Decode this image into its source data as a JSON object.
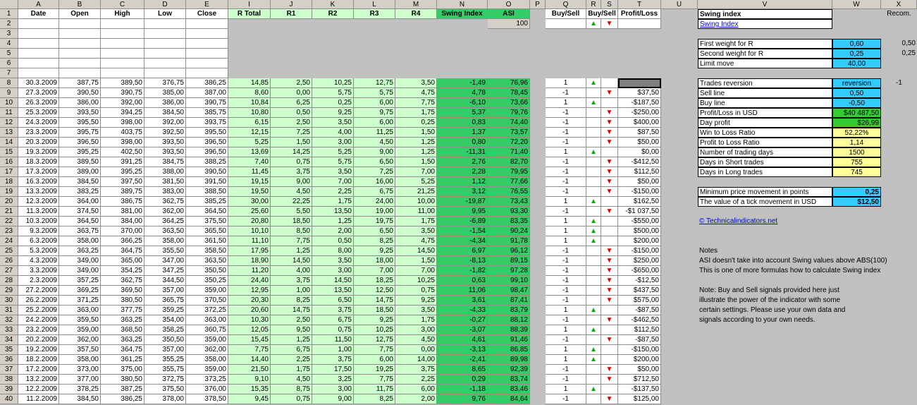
{
  "columns": [
    "A",
    "B",
    "C",
    "D",
    "E",
    "I",
    "J",
    "K",
    "L",
    "M",
    "N",
    "O",
    "P",
    "Q",
    "R",
    "S",
    "T",
    "U",
    "V",
    "W",
    "X"
  ],
  "headers": {
    "date": "Date",
    "open": "Open",
    "high": "High",
    "low": "Low",
    "close": "Close",
    "rtotal": "R Total",
    "r1": "R1",
    "r2": "R2",
    "r3": "R3",
    "r4": "R4",
    "swing": "Swing Index",
    "asi": "ASI",
    "buysell": "Buy/Sell",
    "buysell_arrows": "Buy/Sell",
    "profit_loss": "Profit/Loss"
  },
  "asi_start": "100",
  "arrow_up": "▲",
  "arrow_down": "▼",
  "rows": [
    {
      "n": 8,
      "date": "30.3.2009",
      "open": "387,75",
      "high": "389,50",
      "low": "376,75",
      "close": "386,25",
      "rt": "14,85",
      "r1": "2,50",
      "r2": "10,25",
      "r3": "12,75",
      "r4": "3,50",
      "si": "-1,49",
      "asi": "76,96",
      "bs": "1",
      "dir": "up",
      "pl": ""
    },
    {
      "n": 9,
      "date": "27.3.2009",
      "open": "390,50",
      "high": "390,75",
      "low": "385,00",
      "close": "387,00",
      "rt": "8,60",
      "r1": "0,00",
      "r2": "5,75",
      "r3": "5,75",
      "r4": "4,75",
      "si": "4,78",
      "asi": "78,45",
      "bs": "-1",
      "dir": "down",
      "pl": "$37,50"
    },
    {
      "n": 10,
      "date": "26.3.2009",
      "open": "386,00",
      "high": "392,00",
      "low": "386,00",
      "close": "390,75",
      "rt": "10,84",
      "r1": "6,25",
      "r2": "0,25",
      "r3": "6,00",
      "r4": "7,75",
      "si": "-6,10",
      "asi": "73,66",
      "bs": "1",
      "dir": "up",
      "pl": "-$187,50"
    },
    {
      "n": 11,
      "date": "25.3.2009",
      "open": "393,50",
      "high": "394,25",
      "low": "384,50",
      "close": "385,75",
      "rt": "10,80",
      "r1": "0,50",
      "r2": "9,25",
      "r3": "9,75",
      "r4": "1,75",
      "si": "5,37",
      "asi": "79,76",
      "bs": "-1",
      "dir": "down",
      "pl": "-$250,00"
    },
    {
      "n": 12,
      "date": "24.3.2009",
      "open": "395,50",
      "high": "398,00",
      "low": "392,00",
      "close": "393,75",
      "rt": "6,15",
      "r1": "2,50",
      "r2": "3,50",
      "r3": "6,00",
      "r4": "0,25",
      "si": "0,83",
      "asi": "74,40",
      "bs": "-1",
      "dir": "down",
      "pl": "$400,00"
    },
    {
      "n": 13,
      "date": "23.3.2009",
      "open": "395,75",
      "high": "403,75",
      "low": "392,50",
      "close": "395,50",
      "rt": "12,15",
      "r1": "7,25",
      "r2": "4,00",
      "r3": "11,25",
      "r4": "1,50",
      "si": "1,37",
      "asi": "73,57",
      "bs": "-1",
      "dir": "down",
      "pl": "$87,50"
    },
    {
      "n": 14,
      "date": "20.3.2009",
      "open": "396,50",
      "high": "398,00",
      "low": "393,50",
      "close": "396,50",
      "rt": "5,25",
      "r1": "1,50",
      "r2": "3,00",
      "r3": "4,50",
      "r4": "1,25",
      "si": "0,80",
      "asi": "72,20",
      "bs": "-1",
      "dir": "down",
      "pl": "$50,00"
    },
    {
      "n": 15,
      "date": "19.3.2009",
      "open": "395,25",
      "high": "402,50",
      "low": "393,50",
      "close": "396,50",
      "rt": "13,69",
      "r1": "14,25",
      "r2": "5,25",
      "r3": "9,00",
      "r4": "1,25",
      "si": "-11,31",
      "asi": "71,40",
      "bs": "1",
      "dir": "up",
      "pl": "$0,00"
    },
    {
      "n": 16,
      "date": "18.3.2009",
      "open": "389,50",
      "high": "391,25",
      "low": "384,75",
      "close": "388,25",
      "rt": "7,40",
      "r1": "0,75",
      "r2": "5,75",
      "r3": "6,50",
      "r4": "1,50",
      "si": "2,76",
      "asi": "82,70",
      "bs": "-1",
      "dir": "down",
      "pl": "-$412,50"
    },
    {
      "n": 17,
      "date": "17.3.2009",
      "open": "389,00",
      "high": "395,25",
      "low": "388,00",
      "close": "390,50",
      "rt": "11,45",
      "r1": "3,75",
      "r2": "3,50",
      "r3": "7,25",
      "r4": "7,00",
      "si": "2,28",
      "asi": "79,95",
      "bs": "-1",
      "dir": "down",
      "pl": "$112,50"
    },
    {
      "n": 18,
      "date": "16.3.2009",
      "open": "384,50",
      "high": "397,50",
      "low": "381,50",
      "close": "391,50",
      "rt": "19,15",
      "r1": "9,00",
      "r2": "7,00",
      "r3": "16,00",
      "r4": "5,25",
      "si": "1,12",
      "asi": "77,66",
      "bs": "-1",
      "dir": "down",
      "pl": "$50,00"
    },
    {
      "n": 19,
      "date": "13.3.2009",
      "open": "383,25",
      "high": "389,75",
      "low": "383,00",
      "close": "388,50",
      "rt": "19,50",
      "r1": "4,50",
      "r2": "2,25",
      "r3": "6,75",
      "r4": "21,25",
      "si": "3,12",
      "asi": "76,55",
      "bs": "-1",
      "dir": "down",
      "pl": "-$150,00"
    },
    {
      "n": 20,
      "date": "12.3.2009",
      "open": "364,00",
      "high": "386,75",
      "low": "362,75",
      "close": "385,25",
      "rt": "30,00",
      "r1": "22,25",
      "r2": "1,75",
      "r3": "24,00",
      "r4": "10,00",
      "si": "-19,87",
      "asi": "73,43",
      "bs": "1",
      "dir": "up",
      "pl": "$162,50"
    },
    {
      "n": 21,
      "date": "11.3.2009",
      "open": "374,50",
      "high": "381,00",
      "low": "362,00",
      "close": "364,50",
      "rt": "25,60",
      "r1": "5,50",
      "r2": "13,50",
      "r3": "19,00",
      "r4": "11,00",
      "si": "9,95",
      "asi": "93,30",
      "bs": "-1",
      "dir": "down",
      "pl": "-$1 037,50"
    },
    {
      "n": 22,
      "date": "10.3.2009",
      "open": "364,50",
      "high": "384,00",
      "low": "364,25",
      "close": "375,50",
      "rt": "20,80",
      "r1": "18,50",
      "r2": "1,25",
      "r3": "19,75",
      "r4": "1,75",
      "si": "-6,89",
      "asi": "83,35",
      "bs": "1",
      "dir": "up",
      "pl": "-$550,00"
    },
    {
      "n": 23,
      "date": "9.3.2009",
      "open": "363,75",
      "high": "370,00",
      "low": "363,50",
      "close": "365,50",
      "rt": "10,10",
      "r1": "8,50",
      "r2": "2,00",
      "r3": "6,50",
      "r4": "3,50",
      "si": "-1,54",
      "asi": "90,24",
      "bs": "1",
      "dir": "up",
      "pl": "$500,00"
    },
    {
      "n": 24,
      "date": "6.3.2009",
      "open": "358,00",
      "high": "366,25",
      "low": "358,00",
      "close": "361,50",
      "rt": "11,10",
      "r1": "7,75",
      "r2": "0,50",
      "r3": "8,25",
      "r4": "4,75",
      "si": "-4,34",
      "asi": "91,78",
      "bs": "1",
      "dir": "up",
      "pl": "$200,00"
    },
    {
      "n": 25,
      "date": "5.3.2009",
      "open": "363,25",
      "high": "364,75",
      "low": "355,50",
      "close": "358,50",
      "rt": "17,95",
      "r1": "1,25",
      "r2": "8,00",
      "r3": "9,25",
      "r4": "14,50",
      "si": "6,97",
      "asi": "96,12",
      "bs": "-1",
      "dir": "down",
      "pl": "-$150,00"
    },
    {
      "n": 26,
      "date": "4.3.2009",
      "open": "349,00",
      "high": "365,00",
      "low": "347,00",
      "close": "363,50",
      "rt": "18,90",
      "r1": "14,50",
      "r2": "3,50",
      "r3": "18,00",
      "r4": "1,50",
      "si": "-8,13",
      "asi": "89,15",
      "bs": "-1",
      "dir": "down",
      "pl": "$250,00"
    },
    {
      "n": 27,
      "date": "3.3.2009",
      "open": "349,00",
      "high": "354,25",
      "low": "347,25",
      "close": "350,50",
      "rt": "11,20",
      "r1": "4,00",
      "r2": "3,00",
      "r3": "7,00",
      "r4": "7,00",
      "si": "-1,82",
      "asi": "97,28",
      "bs": "-1",
      "dir": "down",
      "pl": "-$650,00"
    },
    {
      "n": 28,
      "date": "2.3.2009",
      "open": "357,25",
      "high": "362,75",
      "low": "344,50",
      "close": "350,25",
      "rt": "24,40",
      "r1": "3,75",
      "r2": "14,50",
      "r3": "18,25",
      "r4": "10,25",
      "si": "0,63",
      "asi": "99,10",
      "bs": "-1",
      "dir": "down",
      "pl": "-$12,50"
    },
    {
      "n": 29,
      "date": "27.2.2009",
      "open": "369,25",
      "high": "369,50",
      "low": "357,00",
      "close": "359,00",
      "rt": "12,95",
      "r1": "1,00",
      "r2": "13,50",
      "r3": "12,50",
      "r4": "0,75",
      "si": "11,06",
      "asi": "98,47",
      "bs": "-1",
      "dir": "down",
      "pl": "$437,50"
    },
    {
      "n": 30,
      "date": "26.2.2009",
      "open": "371,25",
      "high": "380,50",
      "low": "365,75",
      "close": "370,50",
      "rt": "20,30",
      "r1": "8,25",
      "r2": "6,50",
      "r3": "14,75",
      "r4": "9,25",
      "si": "3,61",
      "asi": "87,41",
      "bs": "-1",
      "dir": "down",
      "pl": "$575,00"
    },
    {
      "n": 31,
      "date": "25.2.2009",
      "open": "363,00",
      "high": "377,75",
      "low": "359,25",
      "close": "372,25",
      "rt": "20,60",
      "r1": "14,75",
      "r2": "3,75",
      "r3": "18,50",
      "r4": "3,50",
      "si": "-4,33",
      "asi": "83,79",
      "bs": "1",
      "dir": "up",
      "pl": "-$87,50"
    },
    {
      "n": 32,
      "date": "24.2.2009",
      "open": "359,50",
      "high": "363,25",
      "low": "354,00",
      "close": "363,00",
      "rt": "10,30",
      "r1": "2,50",
      "r2": "6,75",
      "r3": "9,25",
      "r4": "1,75",
      "si": "-0,27",
      "asi": "88,12",
      "bs": "-1",
      "dir": "down",
      "pl": "-$462,50"
    },
    {
      "n": 33,
      "date": "23.2.2009",
      "open": "359,00",
      "high": "368,50",
      "low": "358,25",
      "close": "360,75",
      "rt": "12,05",
      "r1": "9,50",
      "r2": "0,75",
      "r3": "10,25",
      "r4": "3,00",
      "si": "-3,07",
      "asi": "88,39",
      "bs": "1",
      "dir": "up",
      "pl": "$112,50"
    },
    {
      "n": 34,
      "date": "20.2.2009",
      "open": "362,00",
      "high": "363,25",
      "low": "350,50",
      "close": "359,00",
      "rt": "15,45",
      "r1": "1,25",
      "r2": "11,50",
      "r3": "12,75",
      "r4": "4,50",
      "si": "4,61",
      "asi": "91,46",
      "bs": "-1",
      "dir": "down",
      "pl": "-$87,50"
    },
    {
      "n": 35,
      "date": "19.2.2009",
      "open": "357,50",
      "high": "364,75",
      "low": "357,00",
      "close": "362,00",
      "rt": "7,75",
      "r1": "6,75",
      "r2": "1,00",
      "r3": "7,75",
      "r4": "0,00",
      "si": "-3,13",
      "asi": "86,85",
      "bs": "1",
      "dir": "up",
      "pl": "-$150,00"
    },
    {
      "n": 36,
      "date": "18.2.2009",
      "open": "358,00",
      "high": "361,25",
      "low": "355,25",
      "close": "358,00",
      "rt": "14,40",
      "r1": "2,25",
      "r2": "3,75",
      "r3": "6,00",
      "r4": "14,00",
      "si": "-2,41",
      "asi": "89,98",
      "bs": "1",
      "dir": "up",
      "pl": "$200,00"
    },
    {
      "n": 37,
      "date": "17.2.2009",
      "open": "373,00",
      "high": "375,00",
      "low": "355,75",
      "close": "359,00",
      "rt": "21,50",
      "r1": "1,75",
      "r2": "17,50",
      "r3": "19,25",
      "r4": "3,75",
      "si": "8,65",
      "asi": "92,39",
      "bs": "-1",
      "dir": "down",
      "pl": "$50,00"
    },
    {
      "n": 38,
      "date": "13.2.2009",
      "open": "377,00",
      "high": "380,50",
      "low": "372,75",
      "close": "373,25",
      "rt": "9,10",
      "r1": "4,50",
      "r2": "3,25",
      "r3": "7,75",
      "r4": "2,25",
      "si": "0,29",
      "asi": "83,74",
      "bs": "-1",
      "dir": "down",
      "pl": "$712,50"
    },
    {
      "n": 39,
      "date": "12.2.2009",
      "open": "378,25",
      "high": "387,25",
      "low": "375,50",
      "close": "376,00",
      "rt": "15,35",
      "r1": "8,75",
      "r2": "3,00",
      "r3": "11,75",
      "r4": "6,00",
      "si": "-1,18",
      "asi": "83,46",
      "bs": "1",
      "dir": "up",
      "pl": "-$137,50"
    },
    {
      "n": 40,
      "date": "11.2.2009",
      "open": "384,50",
      "high": "386,25",
      "low": "378,00",
      "close": "378,50",
      "rt": "9,45",
      "r1": "0,75",
      "r2": "9,00",
      "r3": "8,25",
      "r4": "2,00",
      "si": "9,76",
      "asi": "84,64",
      "bs": "-1",
      "dir": "down",
      "pl": "$125,00"
    }
  ],
  "panel": {
    "title": "Swing index",
    "link": "Swing Index",
    "recom": "Recom.",
    "weights": [
      {
        "label": "First weight for R",
        "value": "0,60",
        "recom": "0,50"
      },
      {
        "label": "Second weight for R",
        "value": "0,25",
        "recom": "0,25"
      },
      {
        "label": "Limit move",
        "value": "40,00",
        "recom": ""
      }
    ],
    "stats": [
      {
        "label": "Trades reversion",
        "value": "reversion",
        "side": "-1",
        "color": "#33ccff",
        "align": "c"
      },
      {
        "label": "Sell line",
        "value": "0,50",
        "side": "",
        "color": "#33ccff",
        "align": "c"
      },
      {
        "label": "Buy line",
        "value": "-0,50",
        "side": "",
        "color": "#33ccff",
        "align": "c"
      },
      {
        "label": "Profit/Loss in USD",
        "value": "$40 487,50",
        "side": "",
        "color": "#33cc33",
        "align": "r"
      },
      {
        "label": "Day profit",
        "value": "$26,99",
        "side": "",
        "color": "#33cc33",
        "align": "r"
      },
      {
        "label": "Win to Loss Ratio",
        "value": "52,22%",
        "side": "",
        "color": "#ffff99",
        "align": "c"
      },
      {
        "label": "Profit to Loss Ratio",
        "value": "1,14",
        "side": "",
        "color": "#ffff99",
        "align": "c"
      },
      {
        "label": "Number of trading days",
        "value": "1500",
        "side": "",
        "color": "#ffff99",
        "align": "c"
      },
      {
        "label": "Days in Short trades",
        "value": "755",
        "side": "",
        "color": "#ffff99",
        "align": "c"
      },
      {
        "label": "Days in Long trades",
        "value": "745",
        "side": "",
        "color": "#ffff99",
        "align": "c"
      }
    ],
    "tick": [
      {
        "label": "Minimum price movement in points",
        "value": "0,25"
      },
      {
        "label": "The value of a tick movement in USD",
        "value": "$12,50"
      }
    ],
    "site_link": "© Technicalindicators.net",
    "notes": [
      "Notes",
      "ASI doesn't take into account Swing values above ABS(100)",
      "This is one of more formulas how to calculate Swing index",
      "",
      "Note: Buy and Sell signals provided here just",
      "illustrate the power of the indicator with some",
      "certain settings. Please use your own data and",
      "signals according to your own needs."
    ]
  },
  "colors": {
    "sheet_bg": "#c0c0c0",
    "white": "#ffffff",
    "header_green": "#ccffcc",
    "swing_green": "#33cc66",
    "input_cyan": "#33ccff",
    "result_green": "#33cc33",
    "stat_yellow": "#ffff99",
    "selected": "#808080"
  }
}
